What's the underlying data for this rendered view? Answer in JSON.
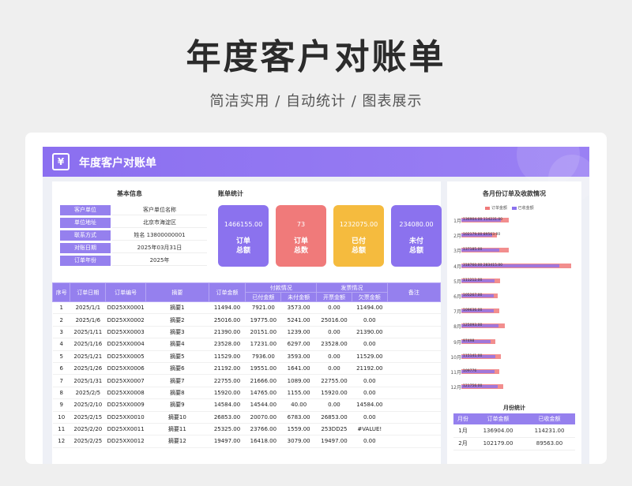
{
  "headline": "年度客户对账单",
  "subline": "简洁实用 / 自动统计 / 图表展示",
  "banner": {
    "title": "年度客户对账单",
    "logo_glyph": "¥"
  },
  "basic_info": {
    "title": "基本信息",
    "rows": [
      {
        "label": "客户单位",
        "value": "客户单位名称"
      },
      {
        "label": "单位地址",
        "value": "北京市海淀区"
      },
      {
        "label": "联系方式",
        "value": "姓名    13800000001"
      },
      {
        "label": "对账日期",
        "value": "2025年03月31日"
      },
      {
        "label": "订单年份",
        "value": "2025年"
      }
    ]
  },
  "stats": {
    "title": "账单统计",
    "cards": [
      {
        "number": "1466155.00",
        "label": "订单\n总额",
        "color": "#8b72ee"
      },
      {
        "number": "73",
        "label": "订单\n总数",
        "color": "#f07a7a"
      },
      {
        "number": "1232075.00",
        "label": "已付\n总额",
        "color": "#f5bb3e"
      },
      {
        "number": "234080.00",
        "label": "未付\n总额",
        "color": "#8b72ee"
      }
    ]
  },
  "orders_table": {
    "headers": {
      "seq": "序号",
      "date": "订单日期",
      "code": "订单编号",
      "summary": "摘要",
      "amount": "订单金额",
      "pay_group": "付款情况",
      "paid": "已付金额",
      "unpaid": "未付金额",
      "invoice_group": "发票情况",
      "invoiced": "开票金额",
      "owed": "欠票金额",
      "note": "备注"
    },
    "rows": [
      [
        "1",
        "2025/1/1",
        "DD25XX0001",
        "摘要1",
        "11494.00",
        "7921.00",
        "3573.00",
        "0.00",
        "11494.00",
        ""
      ],
      [
        "2",
        "2025/1/6",
        "DD25XX0002",
        "摘要2",
        "25016.00",
        "19775.00",
        "5241.00",
        "25016.00",
        "0.00",
        ""
      ],
      [
        "3",
        "2025/1/11",
        "DD25XX0003",
        "摘要3",
        "21390.00",
        "20151.00",
        "1239.00",
        "0.00",
        "21390.00",
        ""
      ],
      [
        "4",
        "2025/1/16",
        "DD25XX0004",
        "摘要4",
        "23528.00",
        "17231.00",
        "6297.00",
        "23528.00",
        "0.00",
        ""
      ],
      [
        "5",
        "2025/1/21",
        "DD25XX0005",
        "摘要5",
        "11529.00",
        "7936.00",
        "3593.00",
        "0.00",
        "11529.00",
        ""
      ],
      [
        "6",
        "2025/1/26",
        "DD25XX0006",
        "摘要6",
        "21192.00",
        "19551.00",
        "1641.00",
        "0.00",
        "21192.00",
        ""
      ],
      [
        "7",
        "2025/1/31",
        "DD25XX0007",
        "摘要7",
        "22755.00",
        "21666.00",
        "1089.00",
        "22755.00",
        "0.00",
        ""
      ],
      [
        "8",
        "2025/2/5",
        "DD25XX0008",
        "摘要8",
        "15920.00",
        "14765.00",
        "1155.00",
        "15920.00",
        "0.00",
        ""
      ],
      [
        "9",
        "2025/2/10",
        "DD25XX0009",
        "摘要9",
        "14584.00",
        "14544.00",
        "40.00",
        "0.00",
        "14584.00",
        ""
      ],
      [
        "10",
        "2025/2/15",
        "DD25XX0010",
        "摘要10",
        "26853.00",
        "20070.00",
        "6783.00",
        "26853.00",
        "0.00",
        ""
      ],
      [
        "11",
        "2025/2/20",
        "DD25XX0011",
        "摘要11",
        "25325.00",
        "23766.00",
        "1559.00",
        "253DD25",
        "#VALUE!",
        ""
      ],
      [
        "12",
        "2025/2/25",
        "DD25XX0012",
        "摘要12",
        "19497.00",
        "16418.00",
        "3079.00",
        "19497.00",
        "0.00",
        ""
      ]
    ]
  },
  "chart_data": {
    "type": "bar",
    "title": "各月份订单及收款情况",
    "categories": [
      "1月",
      "2月",
      "3月",
      "4月",
      "5月",
      "6月",
      "7月",
      "8月",
      "9月",
      "10月",
      "11月",
      "12月"
    ],
    "series": [
      {
        "name": "订单金额",
        "color": "#f07a7a",
        "values": [
          136904,
          102179,
          137185,
          318760,
          111212,
          105267,
          109636,
          125093,
          97498,
          115141,
          109776,
          121756
        ]
      },
      {
        "name": "已收金额",
        "color": "#8b72ee",
        "values": [
          114231,
          89563,
          109219,
          283415,
          95273,
          93145,
          92714,
          107635,
          84179,
          98362,
          95180,
          104926
        ]
      }
    ],
    "data_labels": [
      "136904.00 114231.00",
      "102179.00 89563.00",
      "137185.00",
      "318760.00  283415.00",
      "111212.00",
      "105267.00",
      "109636.00",
      "125093.00",
      "97498",
      "115141.00",
      "109776",
      "121756.00"
    ]
  },
  "monthly": {
    "title": "月份统计",
    "headers": [
      "月份",
      "订单金额",
      "已收金额"
    ],
    "rows": [
      [
        "1月",
        "136904.00",
        "114231.00"
      ],
      [
        "2月",
        "102179.00",
        "89563.00"
      ]
    ]
  }
}
